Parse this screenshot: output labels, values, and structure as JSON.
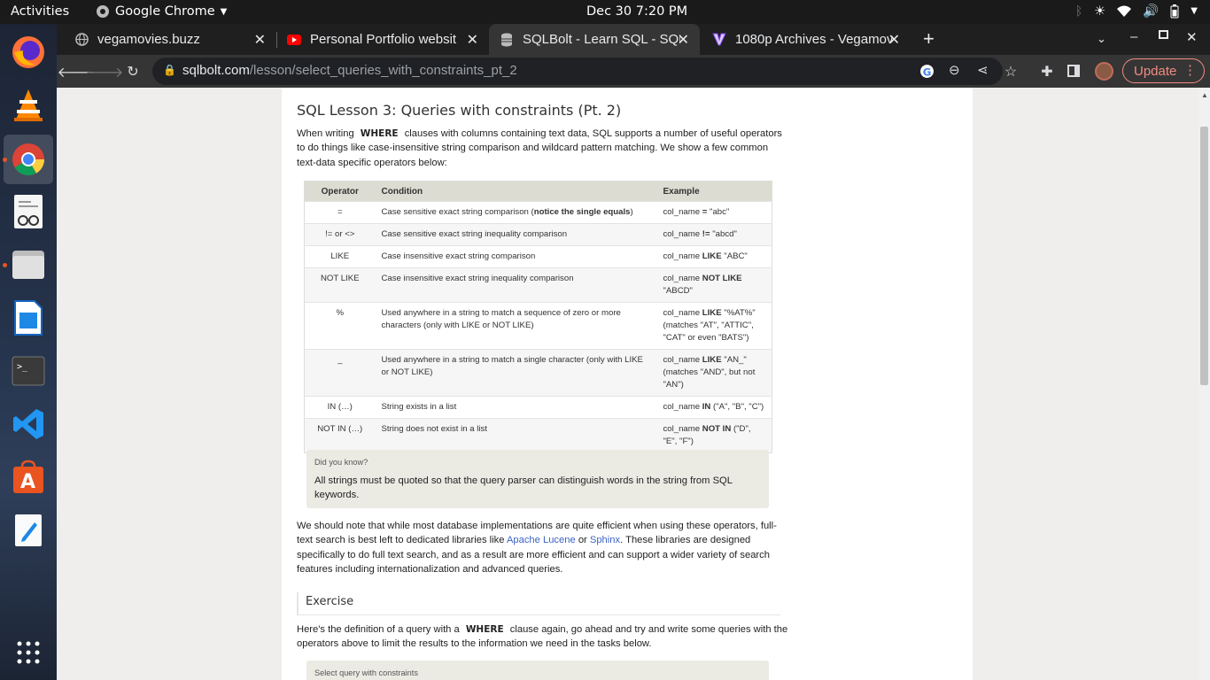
{
  "topbar": {
    "activities": "Activities",
    "app_name": "Google Chrome",
    "clock": "Dec 30  7:20 PM"
  },
  "tabs": [
    {
      "title": "vegamovies.buzz",
      "favicon": "globe-icon",
      "active": false
    },
    {
      "title": "Personal Portfolio websit",
      "favicon": "youtube-icon",
      "active": false
    },
    {
      "title": "SQLBolt - Learn SQL - SQL",
      "favicon": "database-icon",
      "active": true
    },
    {
      "title": "1080p Archives - Vegamov",
      "favicon": "v-logo-icon",
      "active": false
    }
  ],
  "omnibox": {
    "domain": "sqlbolt.com",
    "path": "/lesson/select_queries_with_constraints_pt_2"
  },
  "update_label": "Update",
  "lesson": {
    "title": "SQL Lesson 3: Queries with constraints (Pt. 2)",
    "intro_pre": "When writing",
    "intro_kw": "WHERE",
    "intro_post": "clauses with columns containing text data, SQL supports a number of useful operators to do things like case-insensitive string comparison and wildcard pattern matching. We show a few common text-data specific operators below:",
    "table_headers": {
      "operator": "Operator",
      "condition": "Condition",
      "example": "Example"
    },
    "rows": [
      {
        "op": "=",
        "cond_pre": "Case sensitive exact string comparison (",
        "cond_b": "notice the single equals",
        "cond_post": ")",
        "ex_pre": "col_name ",
        "ex_b": "=",
        "ex_post": " \"abc\""
      },
      {
        "op": "!= or <>",
        "cond_pre": "Case sensitive exact string inequality comparison",
        "cond_b": "",
        "cond_post": "",
        "ex_pre": "col_name ",
        "ex_b": "!=",
        "ex_post": " \"abcd\""
      },
      {
        "op": "LIKE",
        "cond_pre": "Case insensitive exact string comparison",
        "cond_b": "",
        "cond_post": "",
        "ex_pre": "col_name ",
        "ex_b": "LIKE",
        "ex_post": " \"ABC\""
      },
      {
        "op": "NOT LIKE",
        "cond_pre": "Case insensitive exact string inequality comparison",
        "cond_b": "",
        "cond_post": "",
        "ex_pre": "col_name ",
        "ex_b": "NOT LIKE",
        "ex_post": " \"ABCD\""
      },
      {
        "op": "%",
        "cond_pre": "Used anywhere in a string to match a sequence of zero or more characters (only with LIKE or NOT LIKE)",
        "cond_b": "",
        "cond_post": "",
        "ex_pre": "col_name ",
        "ex_b": "LIKE",
        "ex_post": " \"%AT%\" (matches \"AT\", \"ATTIC\", \"CAT\" or even \"BATS\")"
      },
      {
        "op": "_",
        "cond_pre": "Used anywhere in a string to match a single character (only with LIKE or NOT LIKE)",
        "cond_b": "",
        "cond_post": "",
        "ex_pre": "col_name ",
        "ex_b": "LIKE",
        "ex_post": " \"AN_\" (matches \"AND\", but not \"AN\")"
      },
      {
        "op": "IN (…)",
        "cond_pre": "String exists in a list",
        "cond_b": "",
        "cond_post": "",
        "ex_pre": "col_name ",
        "ex_b": "IN",
        "ex_post": " (\"A\", \"B\", \"C\")"
      },
      {
        "op": "NOT IN (…)",
        "cond_pre": "String does not exist in a list",
        "cond_b": "",
        "cond_post": "",
        "ex_pre": "col_name ",
        "ex_b": "NOT IN",
        "ex_post": " (\"D\", \"E\", \"F\")"
      }
    ],
    "did_you_know_heading": "Did you know?",
    "did_you_know_text": "All strings must be quoted so that the query parser can distinguish words in the string from SQL keywords.",
    "note_pre": "We should note that while most database implementations are quite efficient when using these operators, full-text search is best left to dedicated libraries like",
    "note_link1": "Apache Lucene",
    "note_or": "or",
    "note_link2": "Sphinx",
    "note_post": ". These libraries are designed specifically to do full text search, and as a result are more efficient and can support a wider variety of search features including internationalization and advanced queries.",
    "exercise_heading": "Exercise",
    "exercise_pre": "Here's the definition of a query with a",
    "exercise_kw": "WHERE",
    "exercise_post": "clause again, go ahead and try and write some queries with the operators above to limit the results to the information we need in the tasks below.",
    "select_box_heading": "Select query with constraints"
  },
  "colors": {
    "accent_update": "#f28b82",
    "link": "#3b63c4",
    "ubuntu_orange": "#e95420"
  }
}
